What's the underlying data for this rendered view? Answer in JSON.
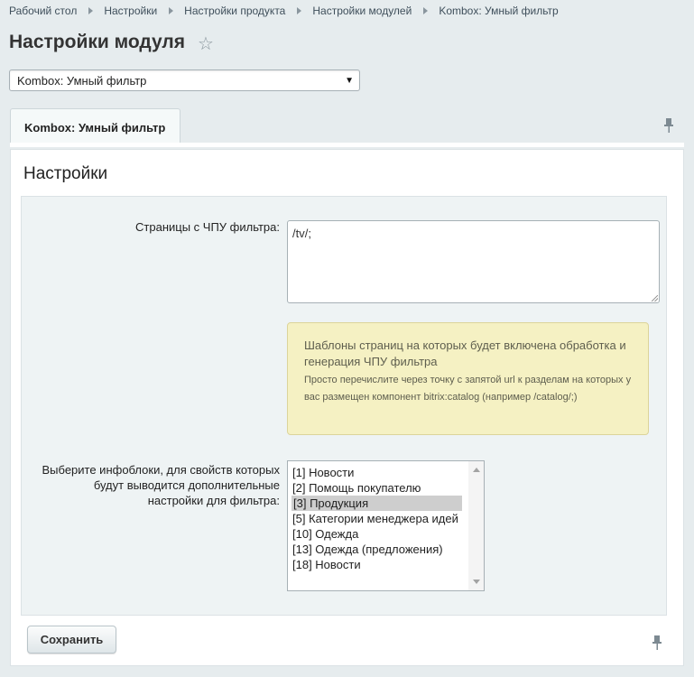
{
  "breadcrumb": [
    "Рабочий стол",
    "Настройки",
    "Настройки продукта",
    "Настройки модулей",
    "Kombox: Умный фильтр"
  ],
  "page_title": "Настройки модуля",
  "module_select": {
    "value": "Kombox: Умный фильтр"
  },
  "tab": {
    "label": "Kombox: Умный фильтр"
  },
  "section_title": "Настройки",
  "fields": {
    "seo_pages": {
      "label": "Страницы с ЧПУ фильтра:",
      "value": "/tv/;"
    },
    "hint": {
      "title": "Шаблоны страниц на которых будет включена обработка и генерация ЧПУ фильтра",
      "text": "Просто перечислите через точку с запятой url к разделам на которых у вас размещен компонент bitrix:catalog (например /catalog/;)"
    },
    "iblocks": {
      "label": "Выберите инфоблоки, для свойств которых будут выводится дополнительные настройки для фильтра:",
      "options": [
        {
          "text": "[1] Новости",
          "selected": false
        },
        {
          "text": "[2] Помощь покупателю",
          "selected": false
        },
        {
          "text": "[3] Продукция",
          "selected": true
        },
        {
          "text": "[5] Категории менеджера идей",
          "selected": false
        },
        {
          "text": "[10] Одежда",
          "selected": false
        },
        {
          "text": "[13] Одежда (предложения)",
          "selected": false
        },
        {
          "text": "[18] Новости",
          "selected": false
        }
      ]
    }
  },
  "save_label": "Сохранить",
  "icons": {
    "favorite": "star-icon",
    "pin": "pin-icon",
    "dropdown": "chevron-down-icon"
  }
}
